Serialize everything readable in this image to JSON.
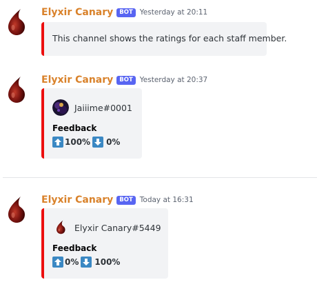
{
  "messages": [
    {
      "author": "Elyxir Canary",
      "badge": "BOT",
      "timestamp": "Yesterday at 20:11",
      "embed": {
        "description": "This channel shows the ratings for each staff member."
      }
    },
    {
      "author": "Elyxir Canary",
      "badge": "BOT",
      "timestamp": "Yesterday at 20:37",
      "embed": {
        "author_name": "Jaiiime#0001",
        "field_name": "Feedback",
        "up_value": "100%",
        "down_value": "0%"
      }
    },
    {
      "author": "Elyxir Canary",
      "badge": "BOT",
      "timestamp": "Today at 16:31",
      "embed": {
        "author_name": "Elyxir Canary#5449",
        "field_name": "Feedback",
        "up_value": "0%",
        "down_value": "100%"
      }
    }
  ],
  "colors": {
    "author": "#d9822b",
    "bot_badge": "#5865f2",
    "embed_border": "#ec0f0f",
    "embed_bg": "#f2f3f5",
    "arrow_bg": "#3b88c3"
  },
  "icons": [
    "blood-drop-avatar-icon",
    "user-avatar-icon",
    "up-arrow-icon",
    "down-arrow-icon"
  ]
}
